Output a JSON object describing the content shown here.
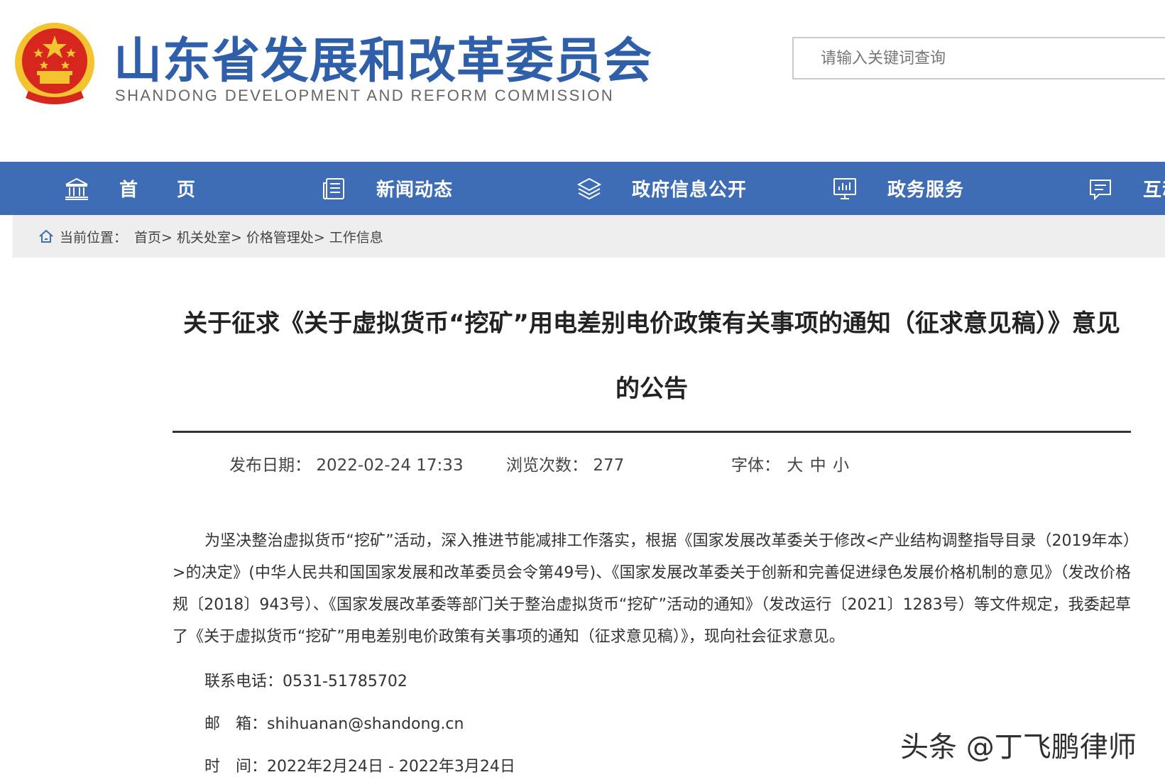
{
  "header": {
    "site_title": "山东省发展和改革委员会",
    "site_subtitle": "SHANDONG DEVELOPMENT AND REFORM COMMISSION",
    "search_placeholder": "请输入关键词查询"
  },
  "nav": {
    "items": [
      {
        "label": "首　　页",
        "icon": "government-building-icon"
      },
      {
        "label": "新闻动态",
        "icon": "news-list-icon"
      },
      {
        "label": "政府信息公开",
        "icon": "layers-icon"
      },
      {
        "label": "政务服务",
        "icon": "monitor-chart-icon"
      },
      {
        "label": "互动",
        "icon": "chat-bubble-icon"
      }
    ]
  },
  "breadcrumb": {
    "prefix": "当前位置：",
    "items": [
      "首页>",
      "机关处室>",
      "价格管理处>",
      "工作信息"
    ]
  },
  "article": {
    "title": "关于征求《关于虚拟货币“挖矿”用电差别电价政策有关事项的通知（征求意见稿）》意见的公告",
    "date_label": "发布日期：",
    "date_value": "2022-02-24 17:33",
    "views_label": "浏览次数：",
    "views_value": "277",
    "font_label": "字体：",
    "font_sizes": [
      "大",
      "中",
      "小"
    ],
    "body_paragraph": "为坚决整治虚拟货币“挖矿”活动，深入推进节能减排工作落实，根据《国家发展改革委关于修改<产业结构调整指导目录（2019年本）>的决定》(中华人民共和国国家发展和改革委员会令第49号)、《国家发展改革委关于创新和完善促进绿色发展价格机制的意见》（发改价格规〔2018〕943号）、《国家发展改革委等部门关于整治虚拟货币“挖矿”活动的通知》（发改运行〔2021〕1283号）等文件规定，我委起草了《关于虚拟货币“挖矿”用电差别电价政策有关事项的通知（征求意见稿）》，现向社会征求意见。",
    "phone_line": "联系电话：0531-51785702",
    "email_line": "邮　箱：shihuanan@shandong.cn",
    "time_line": "时　间：2022年2月24日 - 2022年3月24日"
  },
  "watermark": "头条 @丁飞鹏律师",
  "colors": {
    "brand_blue": "#2e5fa8",
    "nav_blue": "#3e6db5",
    "emblem_red": "#d7261e",
    "emblem_gold": "#f4c430"
  }
}
